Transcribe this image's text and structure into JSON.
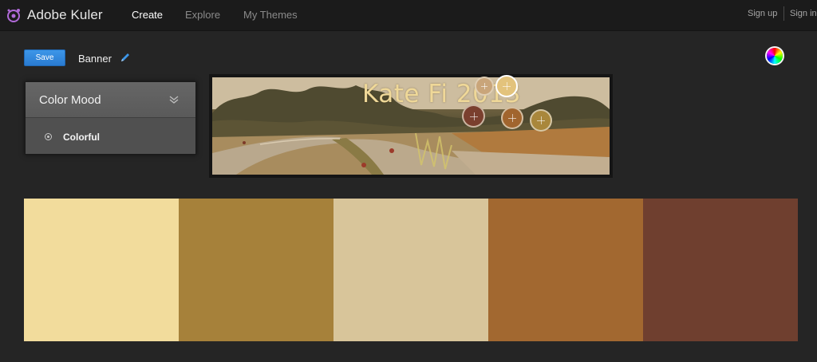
{
  "app": {
    "brand": "Adobe Kuler",
    "nav": [
      "Create",
      "Explore",
      "My Themes"
    ],
    "sign_up": "Sign up",
    "sign_in": "Sign in"
  },
  "toolbar": {
    "save_label": "Save",
    "theme_name": "Banner"
  },
  "mood_panel": {
    "title": "Color Mood",
    "selected": "Colorful"
  },
  "photo": {
    "caption_text": "Kate Fi    2013"
  },
  "pickers": [
    {
      "color": "#c9a57a"
    },
    {
      "color": "#e3c37c"
    },
    {
      "color": "#7a3f2e"
    },
    {
      "color": "#a1652e"
    },
    {
      "color": "#a9873b"
    }
  ],
  "swatches": [
    {
      "color": "#F2DC9C"
    },
    {
      "color": "#A6813A"
    },
    {
      "color": "#D8C59A"
    },
    {
      "color": "#A26830"
    },
    {
      "color": "#6F3F2F"
    }
  ],
  "colors": {
    "accent": "#2A7BD1",
    "background": "#252525",
    "topbar": "#1B1B1B"
  }
}
